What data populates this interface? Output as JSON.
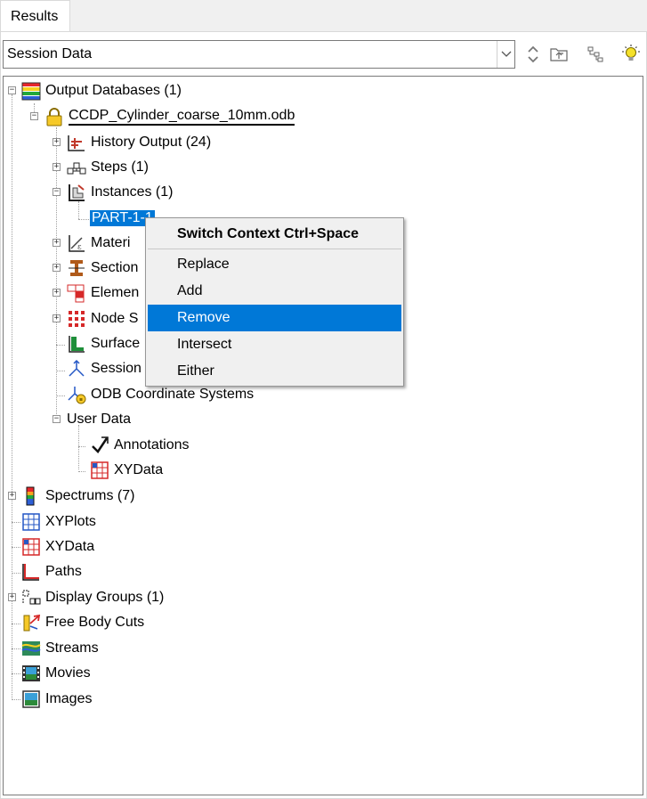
{
  "tab": {
    "label": "Results"
  },
  "combo": {
    "value": "Session Data"
  },
  "toolbar": {
    "up_down": "up-down-arrows-icon",
    "parent": "parent-folder-icon",
    "tree": "tree-filter-icon",
    "tip": "lightbulb-icon"
  },
  "tree": {
    "odb": "Output Databases (1)",
    "odbfile": "CCDP_Cylinder_coarse_10mm.odb",
    "history": "History Output (24)",
    "steps": "Steps (1)",
    "instances": "Instances (1)",
    "part": "PART-1-1",
    "materials": "Materi",
    "sections": "Section",
    "elements": "Elemen",
    "nodesets": "Node S",
    "surfaces": "Surface",
    "session": "Session",
    "odbcoord": "ODB Coordinate Systems",
    "userdata": "User Data",
    "annotations": "Annotations",
    "xydata_user": "XYData",
    "spectrums": "Spectrums (7)",
    "xyplots": "XYPlots",
    "xydata": "XYData",
    "paths": "Paths",
    "displaygroups": "Display Groups (1)",
    "freebody": "Free Body Cuts",
    "streams": "Streams",
    "movies": "Movies",
    "images": "Images"
  },
  "context_menu": {
    "title": "Switch Context  Ctrl+Space",
    "items": [
      "Replace",
      "Add",
      "Remove",
      "Intersect",
      "Either"
    ],
    "highlighted": "Remove"
  }
}
